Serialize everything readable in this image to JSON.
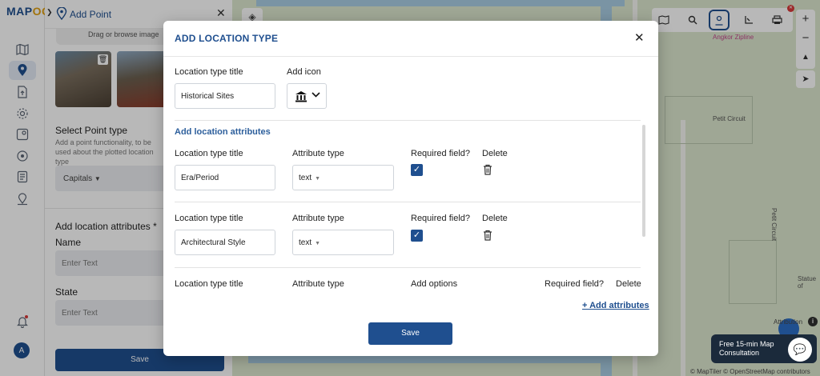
{
  "app": {
    "logo_main": "MAP",
    "logo_accent": "OG"
  },
  "panel": {
    "title": "Add Point",
    "drag_text": "Drag or browse image",
    "select_point_type_title": "Select Point type",
    "select_point_type_desc": "Add a point functionality, to be used about the plotted location type",
    "point_type_value": "Capitals",
    "add_location_attributes": "Add location attributes *",
    "name_label": "Name",
    "name_placeholder": "Enter Text",
    "state_label": "State",
    "state_placeholder": "Enter Text",
    "save_label": "Save"
  },
  "user": {
    "avatar_initial": "A"
  },
  "map": {
    "labels": [
      "Angkor Zipline",
      "Petit Circuit",
      "Petit Circuit",
      "Statue of"
    ],
    "attribution": "Attribution",
    "copyright": "© MapTiler © OpenStreetMap contributors",
    "chat_line1": "Free 15-min Map",
    "chat_line2": "Consultation"
  },
  "modal": {
    "title": "ADD LOCATION TYPE",
    "location_type_title_label": "Location type title",
    "location_type_title_value": "Historical Sites",
    "add_icon_label": "Add icon",
    "add_attributes_header": "Add location attributes",
    "col_title": "Location type title",
    "col_attribute_type": "Attribute type",
    "col_required": "Required field?",
    "col_delete": "Delete",
    "col_add_options": "Add options",
    "attributes": [
      {
        "title": "Era/Period",
        "type": "text",
        "required": true
      },
      {
        "title": "Architectural Style",
        "type": "text",
        "required": true
      }
    ],
    "add_attributes_link": "+ Add attributes",
    "save_label": "Save"
  },
  "colors": {
    "primary": "#1f4f8f",
    "accent": "#e0a012",
    "danger": "#d93a3a"
  }
}
